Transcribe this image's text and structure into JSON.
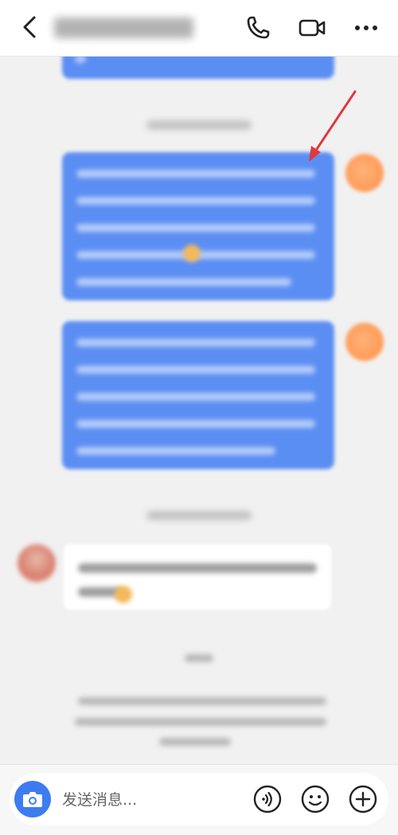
{
  "header": {
    "back_icon": "chevron-left-icon",
    "title": "",
    "call_icon": "phone-icon",
    "video_icon": "video-camera-icon",
    "more_icon": "more-dots-icon"
  },
  "colors": {
    "bubble_blue": "#5b8ef3",
    "accent": "#3d7cf0",
    "annotation_arrow": "#e0393e"
  },
  "composer": {
    "placeholder": "发送消息...",
    "camera_icon": "camera-icon",
    "voice_icon": "voice-icon",
    "emoji_icon": "emoji-icon",
    "add_icon": "plus-circle-icon"
  }
}
